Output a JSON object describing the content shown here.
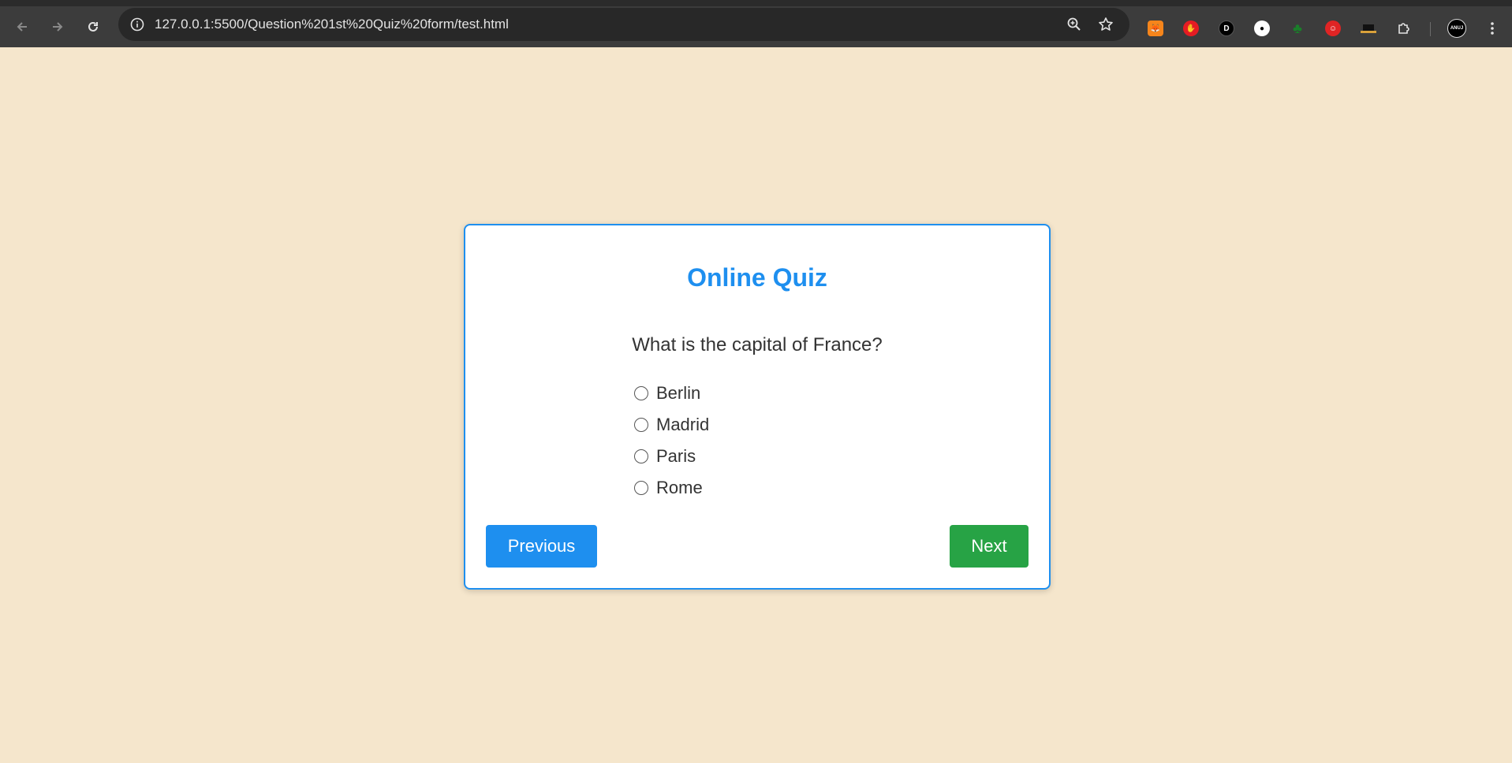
{
  "browser": {
    "url": "127.0.0.1:5500/Question%201st%20Quiz%20form/test.html",
    "icons": {
      "back": "arrow-left-icon",
      "forward": "arrow-right-icon",
      "reload": "reload-icon",
      "site_info": "info-icon",
      "zoom": "zoom-icon",
      "bookmark": "star-icon",
      "extensions": "puzzle-icon",
      "menu": "kebab-menu-icon"
    },
    "extension_icons": [
      {
        "name": "metamask-extension-icon",
        "color": "#f6851b"
      },
      {
        "name": "adblock-extension-icon",
        "color": "#e51c23"
      },
      {
        "name": "dark-extension-icon",
        "color": "#000000"
      },
      {
        "name": "github-extension-icon",
        "color": "#ffffff"
      },
      {
        "name": "clover-extension-icon",
        "color": "#1a7f2a"
      },
      {
        "name": "red-mascot-extension-icon",
        "color": "#e02424"
      },
      {
        "name": "dark-laptop-extension-icon",
        "color": "#d9a13a"
      }
    ],
    "profile_avatar_text": "ANUJ"
  },
  "quiz": {
    "title": "Online Quiz",
    "question": "What is the capital of France?",
    "options": [
      "Berlin",
      "Madrid",
      "Paris",
      "Rome"
    ],
    "previous_label": "Previous",
    "next_label": "Next"
  },
  "colors": {
    "page_background": "#f5e6cc",
    "accent_blue": "#1e8fef",
    "next_green": "#27a345"
  }
}
